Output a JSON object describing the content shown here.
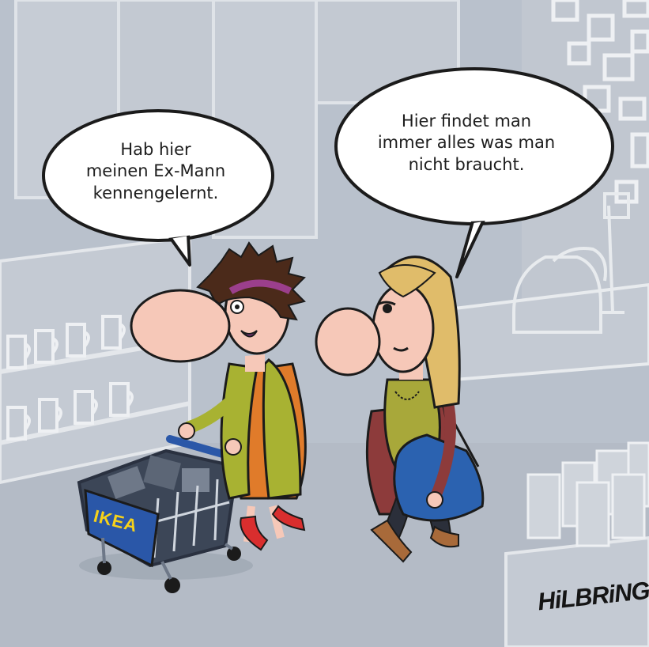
{
  "speech_left": "Hab hier\nmeinen Ex-Mann\nkennengelernt.",
  "speech_right": "Hier findet man\nimmer alles was man\nnicht braucht.",
  "cart_logo": "IKEA",
  "signature": "HiLBRiNG",
  "colors": {
    "background": "#b9c1cc",
    "skin": "#f6c8b8",
    "cart_blue": "#2a57a8",
    "logo_yellow": "#f6d21a",
    "coat_green": "#a8b232",
    "dress_orange": "#e07b2a",
    "shoes_red": "#d92e2e",
    "bag_blue": "#2b62b0"
  }
}
